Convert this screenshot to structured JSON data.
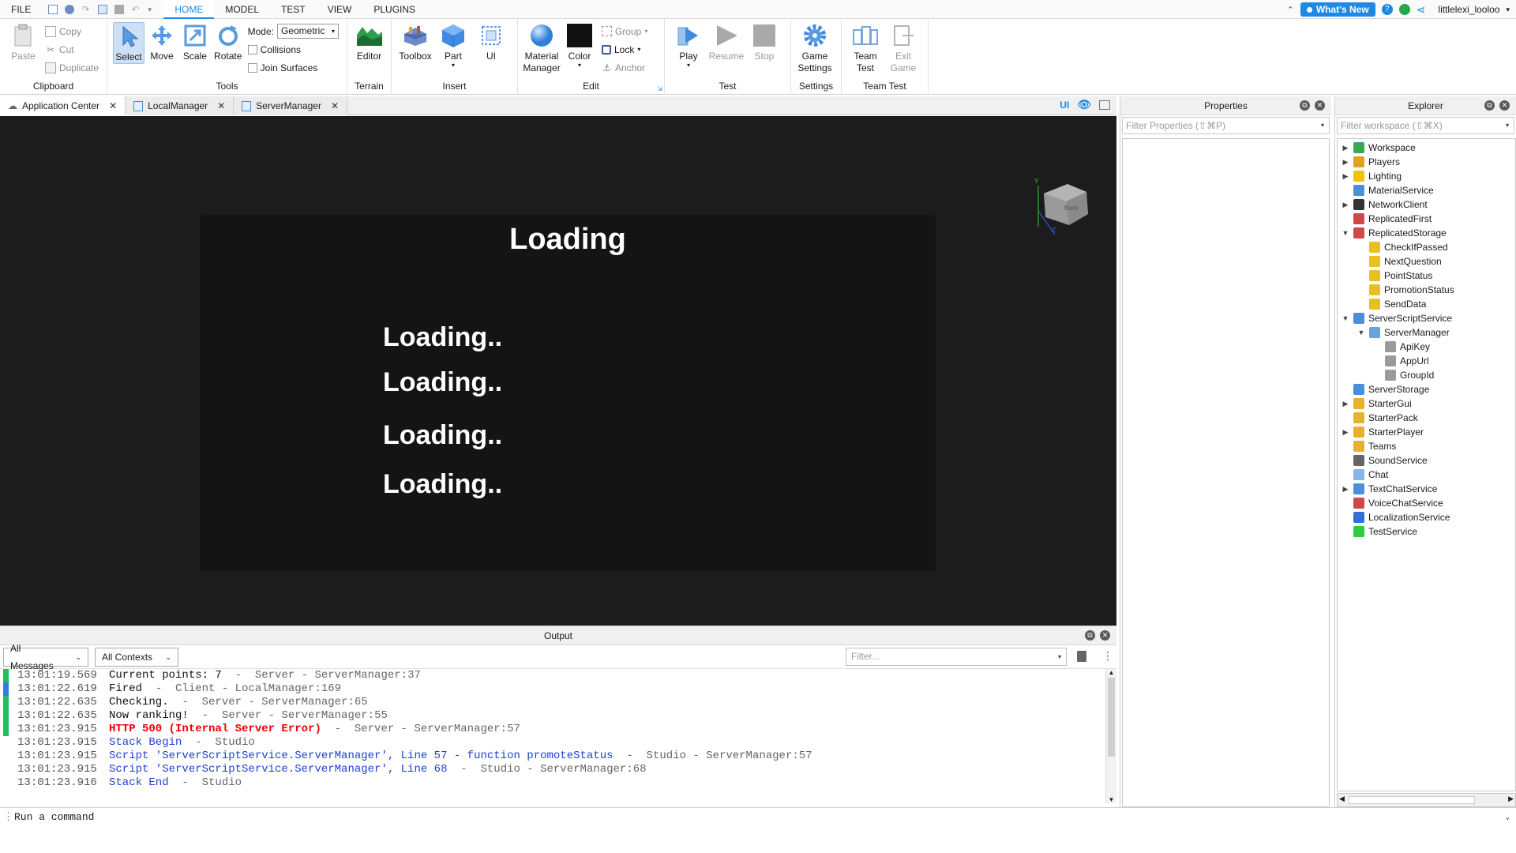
{
  "menubar": {
    "items": [
      "FILE",
      "HOME",
      "MODEL",
      "TEST",
      "VIEW",
      "PLUGINS"
    ],
    "active": "HOME",
    "whats_new": "What's New",
    "username": "littlelexi_looloo"
  },
  "ribbon": {
    "clipboard": {
      "label": "Clipboard",
      "paste": "Paste",
      "copy": "Copy",
      "cut": "Cut",
      "duplicate": "Duplicate"
    },
    "tools": {
      "label": "Tools",
      "select": "Select",
      "move": "Move",
      "scale": "Scale",
      "rotate": "Rotate",
      "mode_label": "Mode:",
      "mode_value": "Geometric",
      "collisions": "Collisions",
      "join_surfaces": "Join Surfaces"
    },
    "terrain": {
      "label": "Terrain",
      "editor": "Editor"
    },
    "insert": {
      "label": "Insert",
      "toolbox": "Toolbox",
      "part": "Part",
      "ui": "UI"
    },
    "edit": {
      "label": "Edit",
      "material_manager": "Material Manager",
      "color": "Color",
      "group": "Group",
      "lock": "Lock",
      "anchor": "Anchor"
    },
    "test": {
      "label": "Test",
      "play": "Play",
      "resume": "Resume",
      "stop": "Stop"
    },
    "settings": {
      "label": "Settings",
      "game_settings": "Game Settings"
    },
    "team_test": {
      "label": "Team Test",
      "team_test": "Team Test",
      "exit_game": "Exit Game"
    }
  },
  "doc_tabs": [
    "Application Center",
    "LocalManager",
    "ServerManager"
  ],
  "view_tools": {
    "ui_toggle": "UI"
  },
  "viewport": {
    "title": "Loading",
    "lines": [
      "Loading..",
      "Loading..",
      "Loading..",
      "Loading.."
    ],
    "cube_face": "Back",
    "axis_y": "Y",
    "axis_z": "Z"
  },
  "output": {
    "title": "Output",
    "filter_messages": "All Messages",
    "filter_contexts": "All Contexts",
    "filter_placeholder": "Filter...",
    "rows": [
      {
        "time": "13:01:19.569",
        "msg": "Current points: 7",
        "src": "  -  Server - ServerManager:37",
        "bar": "#1fc15a",
        "kind": "normal"
      },
      {
        "time": "13:01:22.619",
        "msg": "Fired",
        "src": "  -  Client - LocalManager:169",
        "bar": "#2f7fd6",
        "kind": "normal"
      },
      {
        "time": "13:01:22.635",
        "msg": "Checking.",
        "src": "  -  Server - ServerManager:65",
        "bar": "#1fc15a",
        "kind": "normal"
      },
      {
        "time": "13:01:22.635",
        "msg": "Now ranking!",
        "src": "  -  Server - ServerManager:55",
        "bar": "#1fc15a",
        "kind": "normal"
      },
      {
        "time": "13:01:23.915",
        "msg": "HTTP 500 (Internal Server Error)",
        "src": "  -  Server - ServerManager:57",
        "bar": "#1fc15a",
        "kind": "error"
      },
      {
        "time": "13:01:23.915",
        "msg": "Stack Begin",
        "src": "  -  Studio",
        "bar": "",
        "kind": "blue"
      },
      {
        "time": "13:01:23.915",
        "msg": "Script 'ServerScriptService.ServerManager', Line 57 - function promoteStatus",
        "src": "  -  Studio - ServerManager:57",
        "bar": "",
        "kind": "blue"
      },
      {
        "time": "13:01:23.915",
        "msg": "Script 'ServerScriptService.ServerManager', Line 68",
        "src": "  -  Studio - ServerManager:68",
        "bar": "",
        "kind": "blue"
      },
      {
        "time": "13:01:23.916",
        "msg": "Stack End",
        "src": "  -  Studio",
        "bar": "",
        "kind": "blue"
      }
    ]
  },
  "command_bar": {
    "placeholder": "Run a command"
  },
  "properties": {
    "title": "Properties",
    "filter_placeholder": "Filter Properties (⇧⌘P)"
  },
  "explorer": {
    "title": "Explorer",
    "filter_placeholder": "Filter workspace (⇧⌘X)",
    "items": [
      {
        "label": "Workspace",
        "depth": 0,
        "arrow": "▶",
        "color": "#3aa757"
      },
      {
        "label": "Players",
        "depth": 0,
        "arrow": "▶",
        "color": "#e0a020"
      },
      {
        "label": "Lighting",
        "depth": 0,
        "arrow": "▶",
        "color": "#f2c200"
      },
      {
        "label": "MaterialService",
        "depth": 0,
        "arrow": "",
        "color": "#4a90d9"
      },
      {
        "label": "NetworkClient",
        "depth": 0,
        "arrow": "▶",
        "color": "#333333"
      },
      {
        "label": "ReplicatedFirst",
        "depth": 0,
        "arrow": "",
        "color": "#d04848"
      },
      {
        "label": "ReplicatedStorage",
        "depth": 0,
        "arrow": "▼",
        "color": "#d04848"
      },
      {
        "label": "CheckIfPassed",
        "depth": 1,
        "arrow": "",
        "color": "#e8c020"
      },
      {
        "label": "NextQuestion",
        "depth": 1,
        "arrow": "",
        "color": "#e8c020"
      },
      {
        "label": "PointStatus",
        "depth": 1,
        "arrow": "",
        "color": "#e8c020"
      },
      {
        "label": "PromotionStatus",
        "depth": 1,
        "arrow": "",
        "color": "#e8c020"
      },
      {
        "label": "SendData",
        "depth": 1,
        "arrow": "",
        "color": "#e8c020"
      },
      {
        "label": "ServerScriptService",
        "depth": 0,
        "arrow": "▼",
        "color": "#4a90d9"
      },
      {
        "label": "ServerManager",
        "depth": 1,
        "arrow": "▼",
        "color": "#6aa0e0"
      },
      {
        "label": "ApiKey",
        "depth": 2,
        "arrow": "",
        "color": "#9a9a9a"
      },
      {
        "label": "AppUrl",
        "depth": 2,
        "arrow": "",
        "color": "#9a9a9a"
      },
      {
        "label": "GroupId",
        "depth": 2,
        "arrow": "",
        "color": "#9a9a9a"
      },
      {
        "label": "ServerStorage",
        "depth": 0,
        "arrow": "",
        "color": "#4a90d9"
      },
      {
        "label": "StarterGui",
        "depth": 0,
        "arrow": "▶",
        "color": "#e8b030"
      },
      {
        "label": "StarterPack",
        "depth": 0,
        "arrow": "",
        "color": "#e8b030"
      },
      {
        "label": "StarterPlayer",
        "depth": 0,
        "arrow": "▶",
        "color": "#e8b030"
      },
      {
        "label": "Teams",
        "depth": 0,
        "arrow": "",
        "color": "#e8b030"
      },
      {
        "label": "SoundService",
        "depth": 0,
        "arrow": "",
        "color": "#666666"
      },
      {
        "label": "Chat",
        "depth": 0,
        "arrow": "",
        "color": "#8ab4e8"
      },
      {
        "label": "TextChatService",
        "depth": 0,
        "arrow": "▶",
        "color": "#4a90d9"
      },
      {
        "label": "VoiceChatService",
        "depth": 0,
        "arrow": "",
        "color": "#d04848"
      },
      {
        "label": "LocalizationService",
        "depth": 0,
        "arrow": "",
        "color": "#2f6fd6"
      },
      {
        "label": "TestService",
        "depth": 0,
        "arrow": "",
        "color": "#2ecc40"
      }
    ]
  }
}
